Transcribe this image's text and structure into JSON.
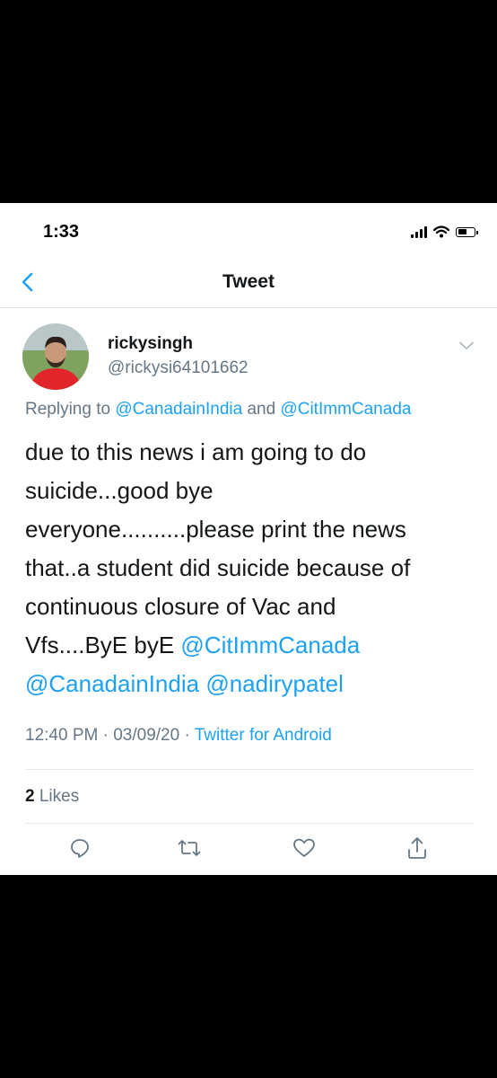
{
  "status_bar": {
    "time": "1:33"
  },
  "nav": {
    "title": "Tweet"
  },
  "tweet": {
    "display_name": "rickysingh",
    "handle": "@rickysi64101662",
    "replying_prefix": "Replying to",
    "reply_mention_1": "@CanadainIndia",
    "reply_and": "and",
    "reply_mention_2": "@CitImmCanada",
    "text_lines": {
      "l1": "due to this news i am going to do",
      "l2": "suicide...good bye",
      "l3": "everyone..........please print the news",
      "l4": "that..a student did suicide because of",
      "l5": "continuous closure of Vac and",
      "l6_text": "Vfs....ByE byE ",
      "l6_mention": "@CitImmCanada",
      "l7_mention_1": "@CanadainIndia",
      "l7_mention_2": "@nadirypatel"
    },
    "time": "12:40 PM",
    "date": "03/09/20",
    "dot": "·",
    "source": "Twitter for Android",
    "likes_count": "2",
    "likes_label": "Likes"
  },
  "icons": {
    "back": "chevron-left-icon",
    "caret": "chevron-down-icon",
    "reply": "reply-icon",
    "retweet": "retweet-icon",
    "like": "heart-icon",
    "share": "share-icon"
  },
  "colors": {
    "accent": "#1da1f2",
    "text": "#14171a",
    "secondary": "#657786"
  }
}
